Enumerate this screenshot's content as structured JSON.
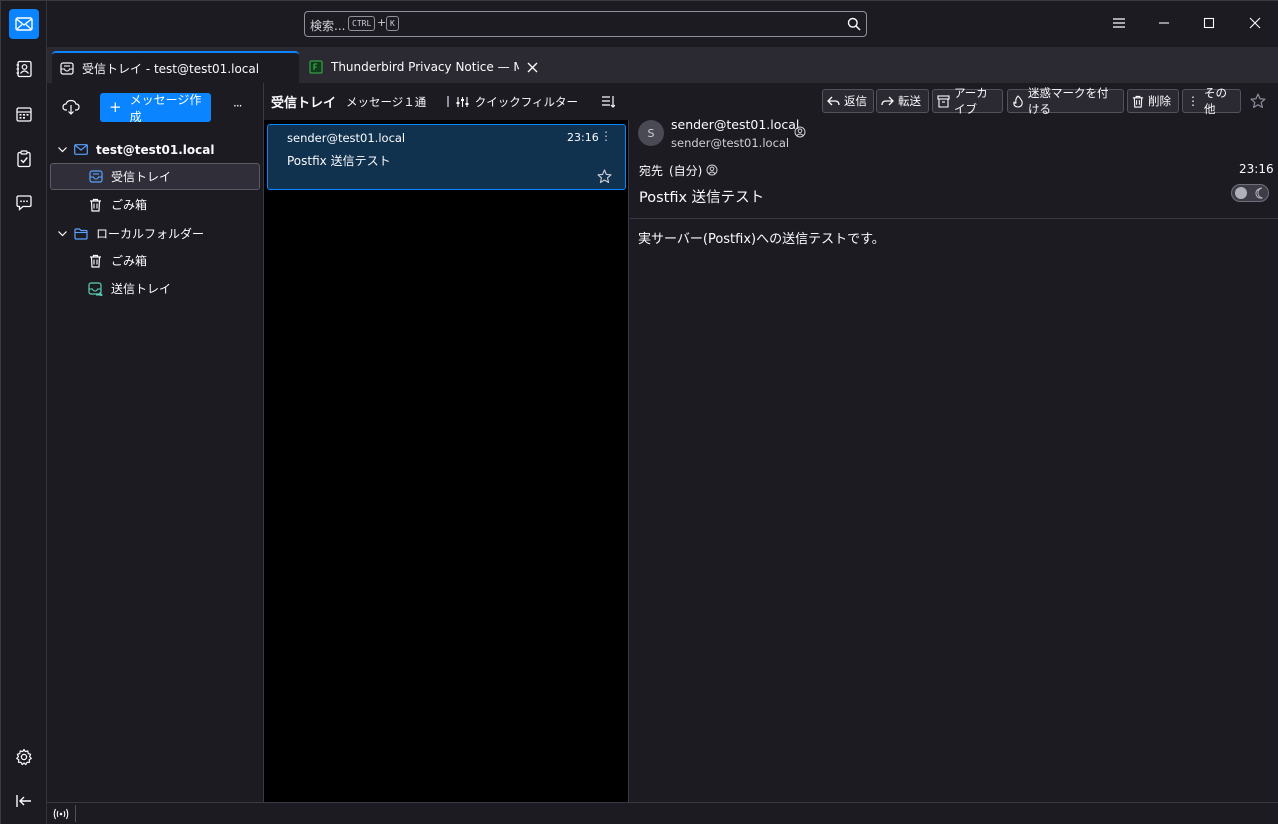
{
  "window": {
    "search_placeholder": "検索...",
    "search_kbd1": "CTRL",
    "search_plus": "+",
    "search_kbd2": "K"
  },
  "tabs": [
    {
      "label": "受信トレイ - test@test01.local",
      "icon": "inbox-icon"
    },
    {
      "label": "Thunderbird Privacy Notice — Mozi",
      "icon": "page-icon"
    }
  ],
  "folder_pane": {
    "compose_label": "メッセージ作成",
    "more_label": "···",
    "account1": "test@test01.local",
    "folders1": [
      {
        "label": "受信トレイ",
        "icon": "inbox-icon",
        "selected": true
      },
      {
        "label": "ごみ箱",
        "icon": "trash-icon"
      }
    ],
    "account2": "ローカルフォルダー",
    "folders2": [
      {
        "label": "ごみ箱",
        "icon": "trash-icon"
      },
      {
        "label": "送信トレイ",
        "icon": "outbox-icon"
      }
    ]
  },
  "message_list": {
    "folder_name": "受信トレイ",
    "count_label": "メッセージ１通",
    "quick_filter_label": "クイックフィルター",
    "messages": [
      {
        "sender": "sender@test01.local",
        "time": "23:16",
        "subject": "Postfix 送信テスト"
      }
    ]
  },
  "message_pane": {
    "buttons": {
      "reply": "返信",
      "forward": "転送",
      "archive": "アーカイブ",
      "junk": "迷惑マークを付ける",
      "delete": "削除",
      "more": "その他"
    },
    "avatar_letter": "S",
    "from_name": "sender@test01.local",
    "from_address": "sender@test01.local",
    "to_label": "宛先",
    "to_value": "(自分)",
    "date": "23:16",
    "subject": "Postfix 送信テスト",
    "body": "実サーバー(Postfix)への送信テストです。"
  },
  "colors": {
    "accent": "#0a84ff",
    "background": "#1c1b22",
    "selected_row": "#10324f"
  }
}
